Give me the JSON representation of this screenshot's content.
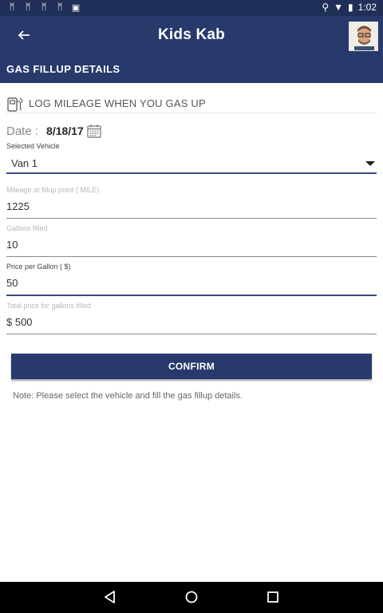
{
  "status_bar": {
    "time": "1:02",
    "left_icons": [
      "notification-icon",
      "notification-icon",
      "notification-icon",
      "notification-icon",
      "image-icon"
    ],
    "right_icons": [
      "location-icon",
      "wifi-icon",
      "battery-icon"
    ]
  },
  "app_bar": {
    "title": "Kids Kab",
    "back_icon": "arrow-left-icon",
    "avatar": "profile-photo"
  },
  "section": {
    "title": "GAS FILLUP DETAILS"
  },
  "log": {
    "icon": "gas-pump-icon",
    "text": "LOG MILEAGE WHEN YOU GAS UP"
  },
  "date": {
    "label": "Date :",
    "value": "8/18/17",
    "icon": "calendar-icon"
  },
  "form": {
    "vehicle": {
      "label": "Selected Vehicle",
      "value": "Van 1"
    },
    "mileage": {
      "label": "Mileage at fillup point ( MILE)",
      "value": "1225"
    },
    "gallons": {
      "label": "Gallons filled",
      "value": "10"
    },
    "price": {
      "label": "Price per Gallon ( $)",
      "value": "50"
    },
    "total": {
      "label": "Total price for gallons filled",
      "value": "$ 500"
    }
  },
  "confirm_label": "CONFIRM",
  "note": "Note: Please select the vehicle and fill the gas fillup details.",
  "nav": [
    "back-triangle-icon",
    "home-circle-icon",
    "recents-square-icon"
  ],
  "colors": {
    "primary": "#28396b",
    "status_bar": "#1f2f57"
  }
}
